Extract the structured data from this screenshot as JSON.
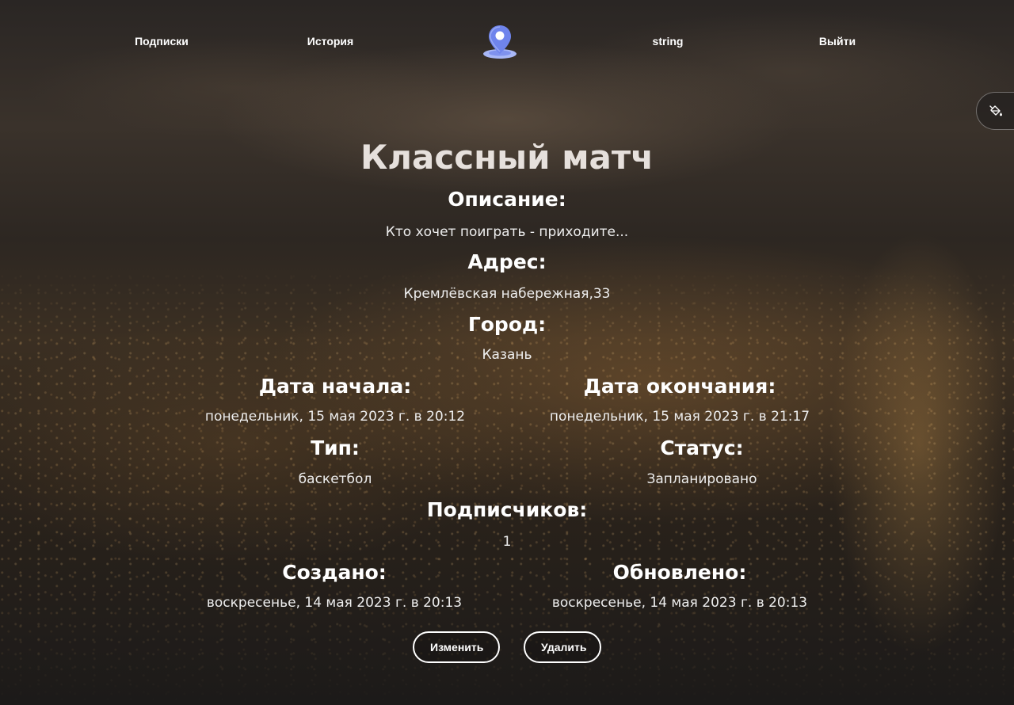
{
  "nav": {
    "subscriptions": "Подписки",
    "history": "История",
    "username": "string",
    "logout": "Выйти"
  },
  "event": {
    "title": "Классный матч",
    "description_label": "Описание:",
    "description": "Кто хочет поиграть - приходите...",
    "address_label": "Адрес:",
    "address": "Кремлёвская набережная,33",
    "city_label": "Город:",
    "city": "Казань",
    "start_label": "Дата начала:",
    "start": "понедельник, 15 мая 2023 г. в 20:12",
    "end_label": "Дата окончания:",
    "end": "понедельник, 15 мая 2023 г. в 21:17",
    "type_label": "Тип:",
    "type": "баскетбол",
    "status_label": "Статус:",
    "status": "Запланировано",
    "subscribers_label": "Подписчиков:",
    "subscribers": "1",
    "created_label": "Создано:",
    "created": "воскресенье, 14 мая 2023 г. в 20:13",
    "updated_label": "Обновлено:",
    "updated": "воскресенье, 14 мая 2023 г. в 20:13"
  },
  "actions": {
    "edit": "Изменить",
    "delete": "Удалить"
  },
  "icons": {
    "logo": "map-pin-icon",
    "theme": "paint-bucket-icon"
  },
  "colors": {
    "logo_pin": "#7b8ff0",
    "logo_base": "#9fb0f5",
    "text": "#ffffff"
  }
}
